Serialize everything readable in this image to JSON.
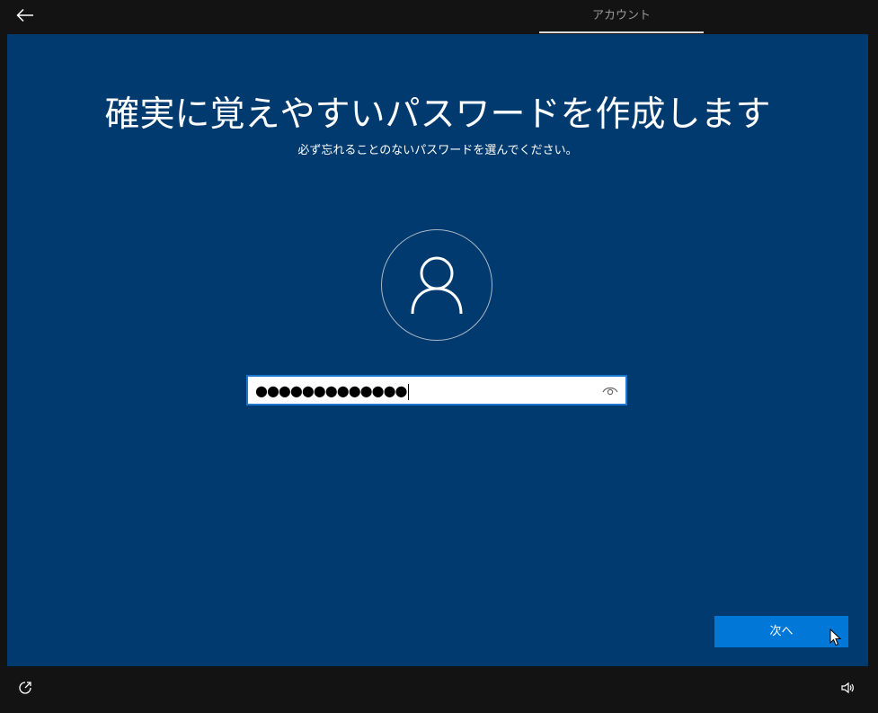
{
  "header": {
    "back_icon": "arrow-left-icon",
    "tab_label": "アカウント"
  },
  "main": {
    "title": "確実に覚えやすいパスワードを作成します",
    "subtitle": "必ず忘れることのないパスワードを選んでください。",
    "avatar_icon": "user-icon",
    "password": {
      "value": "●●●●●●●●●●●●●",
      "reveal_icon": "eye-icon"
    },
    "next_label": "次へ"
  },
  "footer": {
    "ease_of_access_icon": "ease-of-access-icon",
    "volume_icon": "volume-icon"
  },
  "colors": {
    "panel_background": "#003a6e",
    "frame_background": "#131313",
    "primary_button": "#0178d7",
    "input_border": "#1f76d0"
  }
}
